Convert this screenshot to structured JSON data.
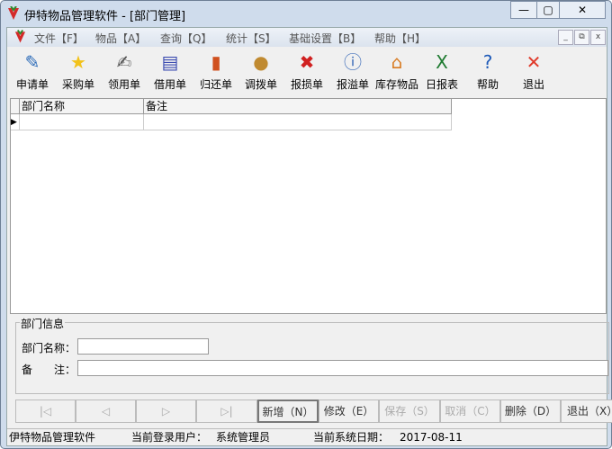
{
  "window": {
    "title": "伊特物品管理软件 - [部门管理]",
    "min": "—",
    "max": "▢",
    "close": "✕"
  },
  "menu": [
    "文件【F】",
    "物品【A】",
    "查询【Q】",
    "统计【S】",
    "基础设置【B】",
    "帮助【H】"
  ],
  "mdi": {
    "min": "_",
    "restore": "⧉",
    "close": "x"
  },
  "toolbar": [
    {
      "label": "申请单",
      "icon": "✎",
      "color": "#2a6ab8"
    },
    {
      "label": "采购单",
      "icon": "★",
      "color": "#f2c21a"
    },
    {
      "label": "领用单",
      "icon": "✍",
      "color": "#555"
    },
    {
      "label": "借用单",
      "icon": "▤",
      "color": "#3a4ab0"
    },
    {
      "label": "归还单",
      "icon": "▮",
      "color": "#d0501e"
    },
    {
      "label": "调拨单",
      "icon": "●",
      "color": "#c08a30"
    },
    {
      "label": "报损单",
      "icon": "✖",
      "color": "#d02020"
    },
    {
      "label": "报溢单",
      "icon": "ⓘ",
      "color": "#3a6ab8"
    },
    {
      "label": "库存物品",
      "icon": "⌂",
      "color": "#d87a20"
    },
    {
      "label": "日报表",
      "icon": "X",
      "color": "#1e7a30"
    },
    {
      "label": "帮助",
      "icon": "?",
      "color": "#1e5ab8"
    },
    {
      "label": "退出",
      "icon": "✕",
      "color": "#e03a2a"
    }
  ],
  "grid": {
    "columns": [
      "部门名称",
      "备注"
    ]
  },
  "form": {
    "group": "部门信息",
    "name_label": "部门名称：",
    "name_value": "",
    "remark_label": "备　　注：",
    "remark_value": ""
  },
  "buttons": {
    "first": "|◁",
    "prev": "◁",
    "next": "▷",
    "last": "▷|",
    "new": "新增（N）",
    "edit": "修改（E）",
    "save": "保存（S）",
    "cancel": "取消（C）",
    "delete": "删除（D）",
    "exit": "退出（X）"
  },
  "status": {
    "app": "伊特物品管理软件",
    "user_label": "当前登录用户：",
    "user": "系统管理员",
    "date_label": "当前系统日期：",
    "date": "2017-08-11"
  }
}
